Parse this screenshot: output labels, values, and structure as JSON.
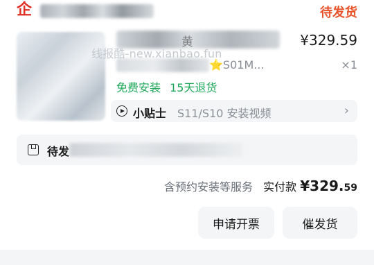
{
  "header": {
    "logo_char": "企",
    "status": "待发货"
  },
  "product": {
    "title_partial": "黄",
    "price": "¥329.59",
    "spec_partial": "⭐S01M...",
    "qty": "×1",
    "service_tags": [
      "免费安装",
      "15天退货"
    ],
    "watermark": "线报酷-new.xianbao.fun"
  },
  "tip": {
    "label": "小贴士",
    "text": "S11/S10 安装视频",
    "chevron": "›"
  },
  "pending": {
    "label": "待发"
  },
  "summary": {
    "note": "含预约安装等服务",
    "label": "实付款",
    "amount_main": "¥329.",
    "amount_cents": "59"
  },
  "actions": {
    "invoice": "申请开票",
    "urge": "催发货"
  },
  "colors": {
    "status_orange": "#e8532b",
    "service_green": "#1fa75a",
    "logo_red": "#e02e24"
  }
}
